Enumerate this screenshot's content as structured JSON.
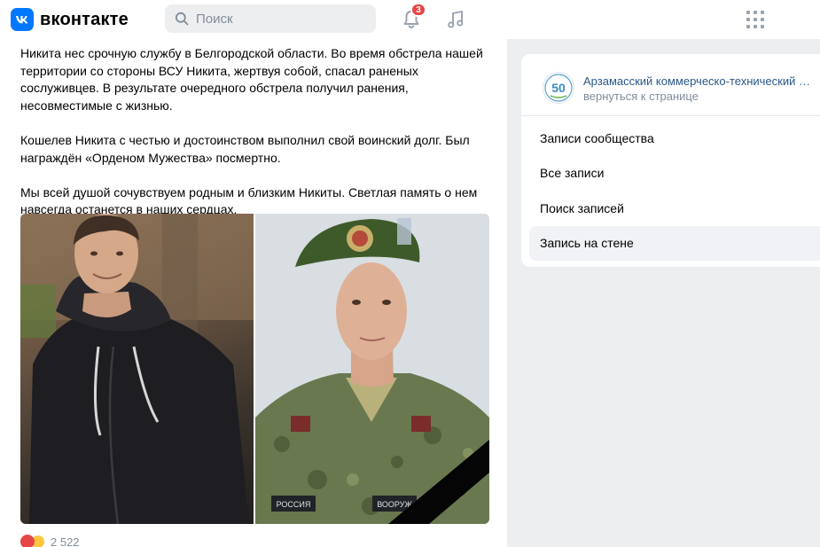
{
  "header": {
    "logo_text": "вконтакте",
    "search_placeholder": "Поиск",
    "notifications_count": "3"
  },
  "post": {
    "paragraphs": [
      "Никита нес срочную службу в Белгородской области. Во время обстрела нашей территории со стороны ВСУ Никита, жертвуя собой, спасал раненых сослуживцев. В результате очередного обстрела получил ранения, несовместимые с жизнью.",
      "Кошелев Никита с честью и достоинством выполнил свой воинский долг. Был награждён «Орденом Мужества» посмертно.",
      "Мы всей душой сочувствуем родным и близким Никиты. Светлая память о нем навсегда останется в наших сердцах."
    ],
    "photo_2_patch_text": [
      "РОССИЯ",
      "ВООРУЖ"
    ],
    "likes": "2 522"
  },
  "sidebar": {
    "group_name": "Арзамасский коммерческо-технический …",
    "group_back": "вернуться к странице",
    "group_logo_text": "50",
    "menu": [
      {
        "label": "Записи сообщества"
      },
      {
        "label": "Все записи"
      },
      {
        "label": "Поиск записей"
      },
      {
        "label": "Запись на стене"
      }
    ]
  },
  "colors": {
    "accent": "#0077ff",
    "link": "#2a5885",
    "badge": "#e64646",
    "muted": "#818c99",
    "background": "#edeef0"
  }
}
